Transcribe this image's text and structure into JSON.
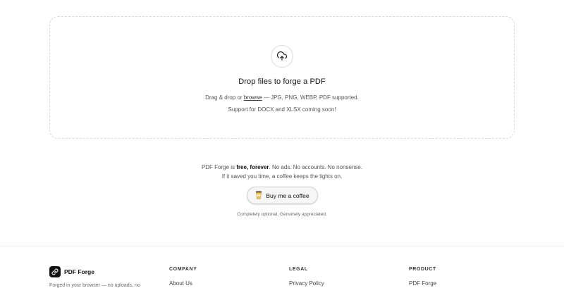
{
  "dropzone": {
    "icon": "upload-cloud-icon",
    "title": "Drop files to forge a PDF",
    "line1_prefix": "Drag & drop or ",
    "browse_label": "browse",
    "line1_suffix": " — JPG, PNG, WEBP, PDF supported.",
    "line2": "Support for DOCX and XLSX coming soon!"
  },
  "support": {
    "prefix": "PDF Forge is ",
    "emphasis": "free, forever",
    "suffix": ". No ads. No accounts. No nonsense.",
    "line2": "If it saved you time, a coffee keeps the lights on.",
    "button_icon": "coffee-cup-icon",
    "button_label": "Buy me a coffee",
    "note": "Completely optional. Genuinely appreciated."
  },
  "footer": {
    "brand_name": "PDF Forge",
    "brand_icon": "link-icon",
    "tagline": "Forged in your browser — no uploads, no",
    "columns": [
      {
        "heading": "COMPANY",
        "first_link": "About Us"
      },
      {
        "heading": "LEGAL",
        "first_link": "Privacy Policy"
      },
      {
        "heading": "PRODUCT",
        "first_link": "PDF Forge"
      }
    ]
  }
}
